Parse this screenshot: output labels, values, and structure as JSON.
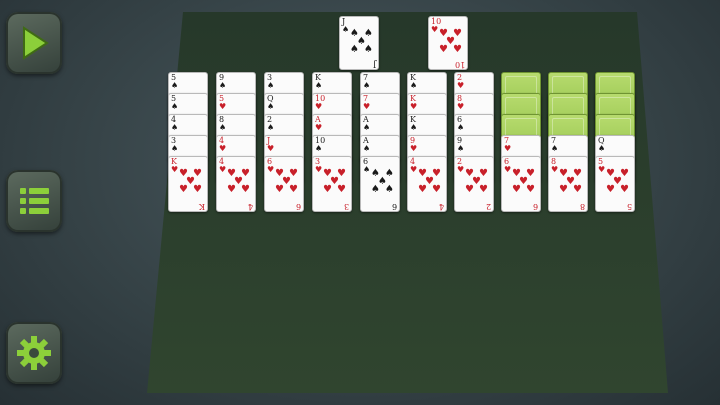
{
  "buttons": {
    "play": {
      "icon": "play-icon"
    },
    "menu": {
      "icon": "menu-list-icon"
    },
    "settings": {
      "icon": "gear-icon"
    }
  },
  "colors": {
    "accent": "#8ccf3a",
    "felt": "#2a3b2d",
    "card_back": "#a6d05c",
    "red_suit": "#c8202a"
  },
  "foundation": [
    {
      "rank": "J",
      "suit": "♠",
      "color": "black"
    },
    {
      "rank": "10",
      "suit": "♥",
      "color": "red"
    }
  ],
  "tableau": [
    {
      "faceDown": 0,
      "cards": [
        {
          "rank": "5",
          "suit": "♠",
          "color": "black"
        },
        {
          "rank": "5",
          "suit": "♠",
          "color": "black"
        },
        {
          "rank": "4",
          "suit": "♠",
          "color": "black"
        },
        {
          "rank": "3",
          "suit": "♠",
          "color": "black"
        },
        {
          "rank": "K",
          "suit": "♥",
          "color": "red"
        }
      ]
    },
    {
      "faceDown": 0,
      "cards": [
        {
          "rank": "9",
          "suit": "♠",
          "color": "black"
        },
        {
          "rank": "5",
          "suit": "♥",
          "color": "red"
        },
        {
          "rank": "8",
          "suit": "♠",
          "color": "black"
        },
        {
          "rank": "4",
          "suit": "♥",
          "color": "red"
        },
        {
          "rank": "4",
          "suit": "♥",
          "color": "red"
        }
      ]
    },
    {
      "faceDown": 0,
      "cards": [
        {
          "rank": "3",
          "suit": "♠",
          "color": "black"
        },
        {
          "rank": "Q",
          "suit": "♠",
          "color": "black"
        },
        {
          "rank": "2",
          "suit": "♠",
          "color": "black"
        },
        {
          "rank": "J",
          "suit": "♥",
          "color": "red"
        },
        {
          "rank": "6",
          "suit": "♥",
          "color": "red"
        }
      ]
    },
    {
      "faceDown": 0,
      "cards": [
        {
          "rank": "K",
          "suit": "♠",
          "color": "black"
        },
        {
          "rank": "10",
          "suit": "♥",
          "color": "red"
        },
        {
          "rank": "A",
          "suit": "♥",
          "color": "red"
        },
        {
          "rank": "10",
          "suit": "♠",
          "color": "black"
        },
        {
          "rank": "3",
          "suit": "♥",
          "color": "red"
        }
      ]
    },
    {
      "faceDown": 0,
      "cards": [
        {
          "rank": "7",
          "suit": "♠",
          "color": "black"
        },
        {
          "rank": "7",
          "suit": "♥",
          "color": "red"
        },
        {
          "rank": "A",
          "suit": "♠",
          "color": "black"
        },
        {
          "rank": "A",
          "suit": "♠",
          "color": "black"
        },
        {
          "rank": "6",
          "suit": "♠",
          "color": "black"
        }
      ]
    },
    {
      "faceDown": 0,
      "cards": [
        {
          "rank": "K",
          "suit": "♠",
          "color": "black"
        },
        {
          "rank": "K",
          "suit": "♥",
          "color": "red"
        },
        {
          "rank": "K",
          "suit": "♠",
          "color": "black"
        },
        {
          "rank": "9",
          "suit": "♥",
          "color": "red"
        },
        {
          "rank": "4",
          "suit": "♥",
          "color": "red"
        }
      ]
    },
    {
      "faceDown": 0,
      "cards": [
        {
          "rank": "2",
          "suit": "♥",
          "color": "red"
        },
        {
          "rank": "8",
          "suit": "♥",
          "color": "red"
        },
        {
          "rank": "6",
          "suit": "♠",
          "color": "black"
        },
        {
          "rank": "9",
          "suit": "♠",
          "color": "black"
        },
        {
          "rank": "2",
          "suit": "♥",
          "color": "red"
        }
      ]
    },
    {
      "faceDown": 3,
      "cards": [
        {
          "rank": "7",
          "suit": "♥",
          "color": "red"
        },
        {
          "rank": "6",
          "suit": "♥",
          "color": "red"
        }
      ]
    },
    {
      "faceDown": 3,
      "cards": [
        {
          "rank": "7",
          "suit": "♠",
          "color": "black"
        },
        {
          "rank": "8",
          "suit": "♥",
          "color": "red"
        }
      ]
    },
    {
      "faceDown": 3,
      "cards": [
        {
          "rank": "Q",
          "suit": "♠",
          "color": "black"
        },
        {
          "rank": "5",
          "suit": "♥",
          "color": "red"
        }
      ]
    }
  ]
}
